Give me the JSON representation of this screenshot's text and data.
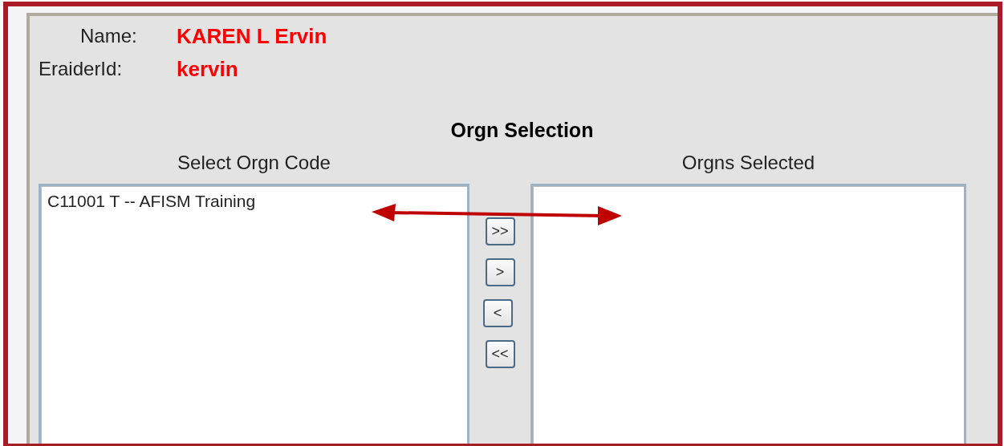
{
  "user": {
    "fields": [
      {
        "label": "Name:",
        "value": "KAREN L Ervin"
      },
      {
        "label": "EraiderId:",
        "value": "kervin"
      }
    ]
  },
  "orgn_selection": {
    "title": "Orgn Selection",
    "available": {
      "heading": "Select Orgn Code",
      "items": [
        {
          "label": "C11001 T -- AFISM Training",
          "selected": false
        }
      ]
    },
    "buttons": [
      ">>",
      ">",
      "<",
      "<<"
    ],
    "selected": {
      "heading": "Orgns Selected"
    }
  }
}
